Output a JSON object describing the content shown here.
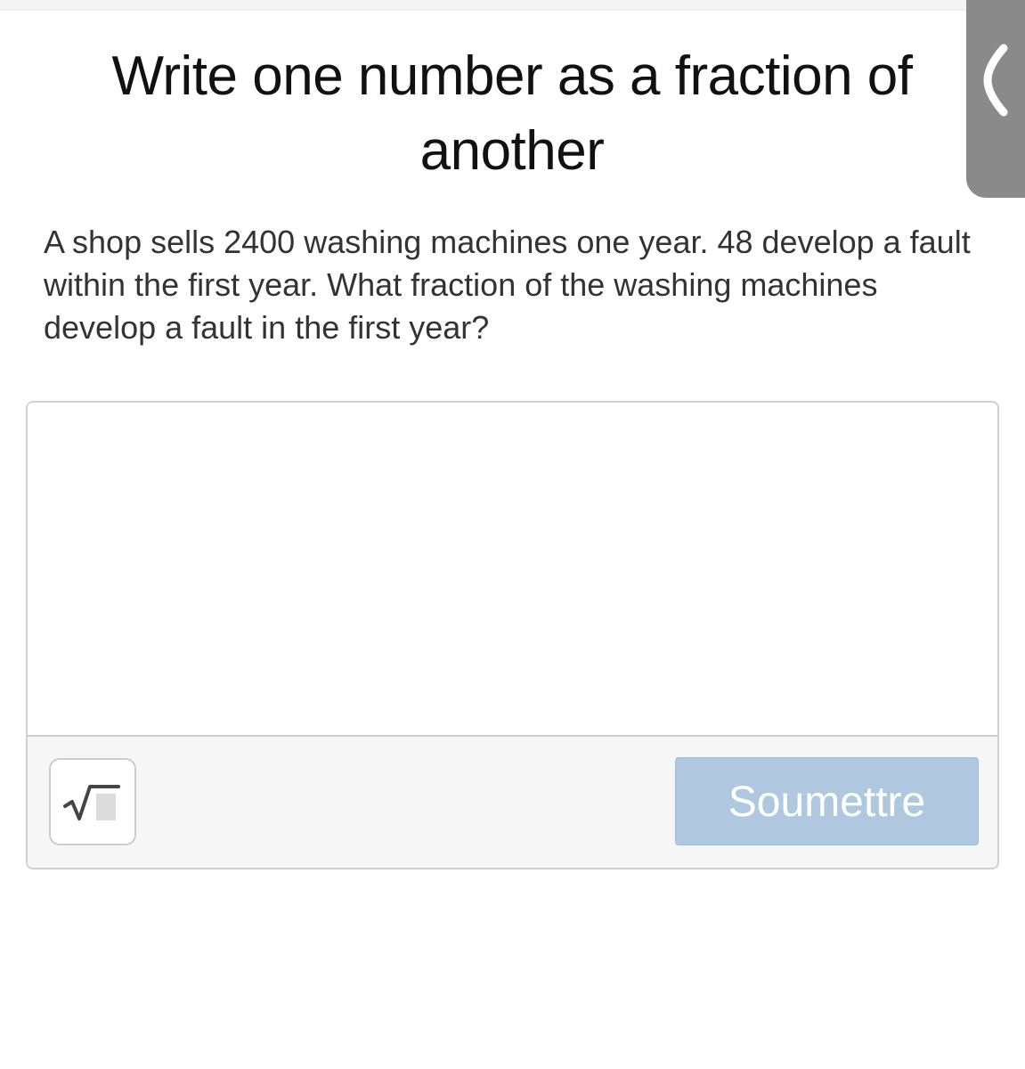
{
  "header": {
    "title": "Write one number as a fraction of another"
  },
  "question": {
    "text": "A shop sells 2400 washing machines one year. 48 develop a fault within the first year. What fraction of the washing machines develop a fault in the first year?"
  },
  "answer": {
    "value": "",
    "placeholder": ""
  },
  "toolbar": {
    "math_button_icon": "square-root-icon",
    "submit_label": "Soumettre"
  },
  "side_panel": {
    "icon": "chevron-left-icon"
  },
  "colors": {
    "submit_bg": "#b0c8df",
    "side_tab_bg": "#8a8a8a"
  }
}
